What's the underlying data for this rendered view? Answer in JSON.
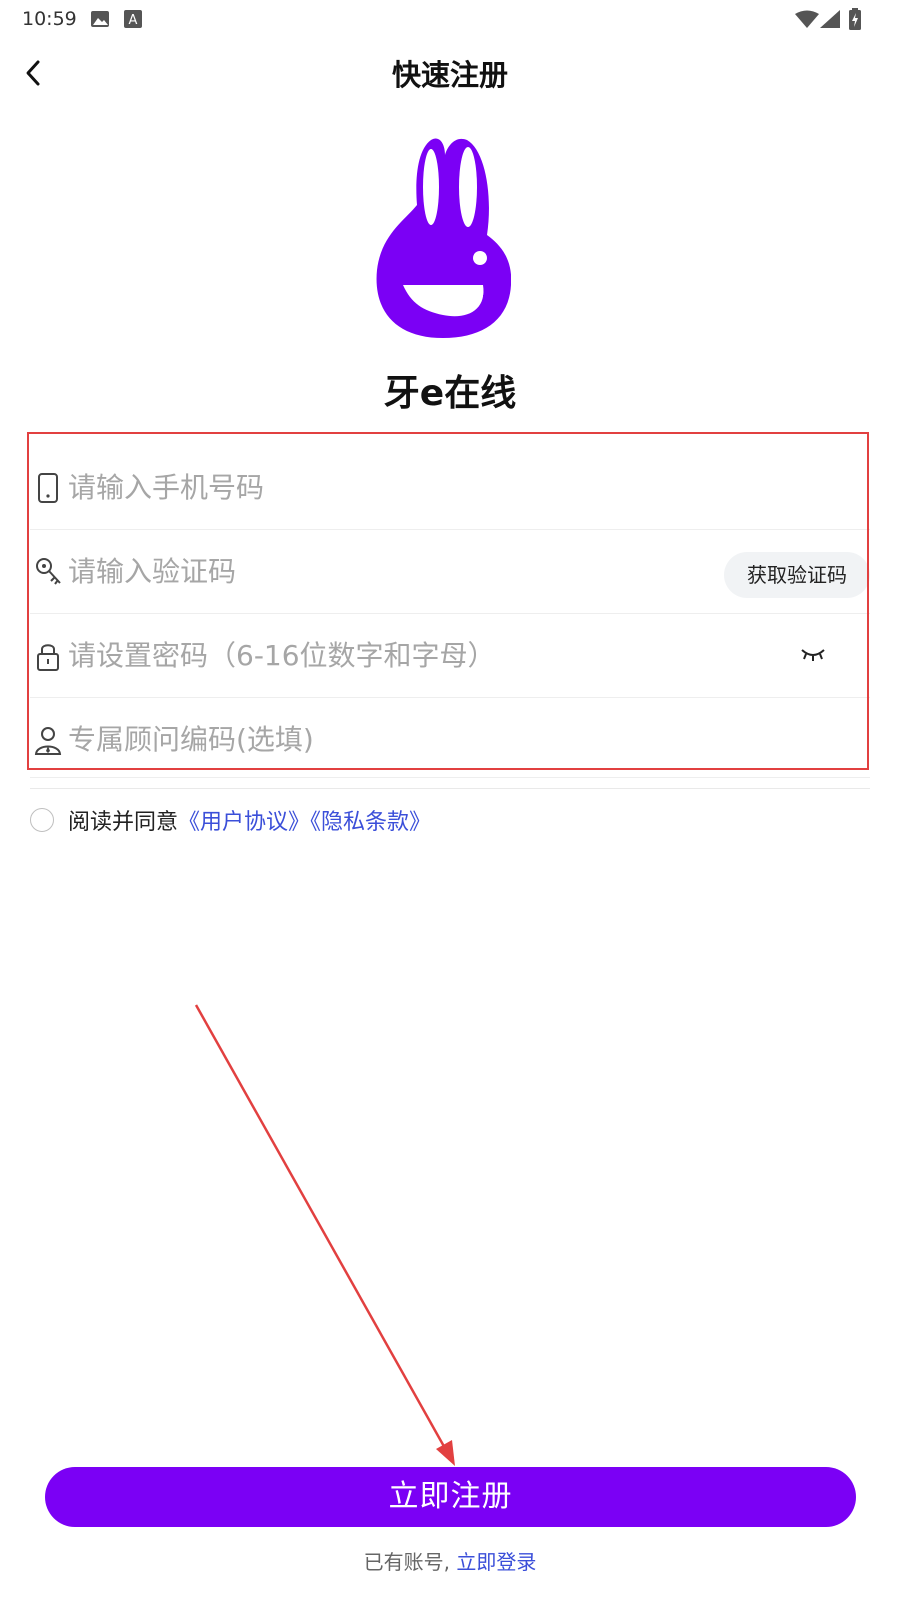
{
  "status_bar": {
    "time": "10:59",
    "icons": [
      "image-icon",
      "a-notification-icon",
      "wifi-icon",
      "signal-icon",
      "battery-icon"
    ]
  },
  "header": {
    "back_icon": "chevron-left-icon",
    "title": "快速注册"
  },
  "logo": {
    "icon": "rabbit-e-logo-icon",
    "brand_color": "#7b00f5"
  },
  "app_name": "牙e在线",
  "form": {
    "phone": {
      "icon": "phone-icon",
      "placeholder": "请输入手机号码",
      "value": ""
    },
    "code": {
      "icon": "key-icon",
      "placeholder": "请输入验证码",
      "value": "",
      "button_label": "获取验证码"
    },
    "password": {
      "icon": "lock-icon",
      "placeholder": "请设置密码（6-16位数字和字母）",
      "value": "",
      "toggle_icon": "eye-closed-icon"
    },
    "advisor": {
      "icon": "user-icon",
      "placeholder": "专属顾问编码(选填)",
      "value": ""
    },
    "highlight_color": "#e24040"
  },
  "agreement": {
    "prefix": "阅读并同意",
    "user_agreement": "《用户协议》",
    "privacy": "《隐私条款》",
    "checked": false,
    "link_color": "#3b4fd9"
  },
  "register_button": "立即注册",
  "login": {
    "prompt": "已有账号,",
    "link": "立即登录"
  }
}
